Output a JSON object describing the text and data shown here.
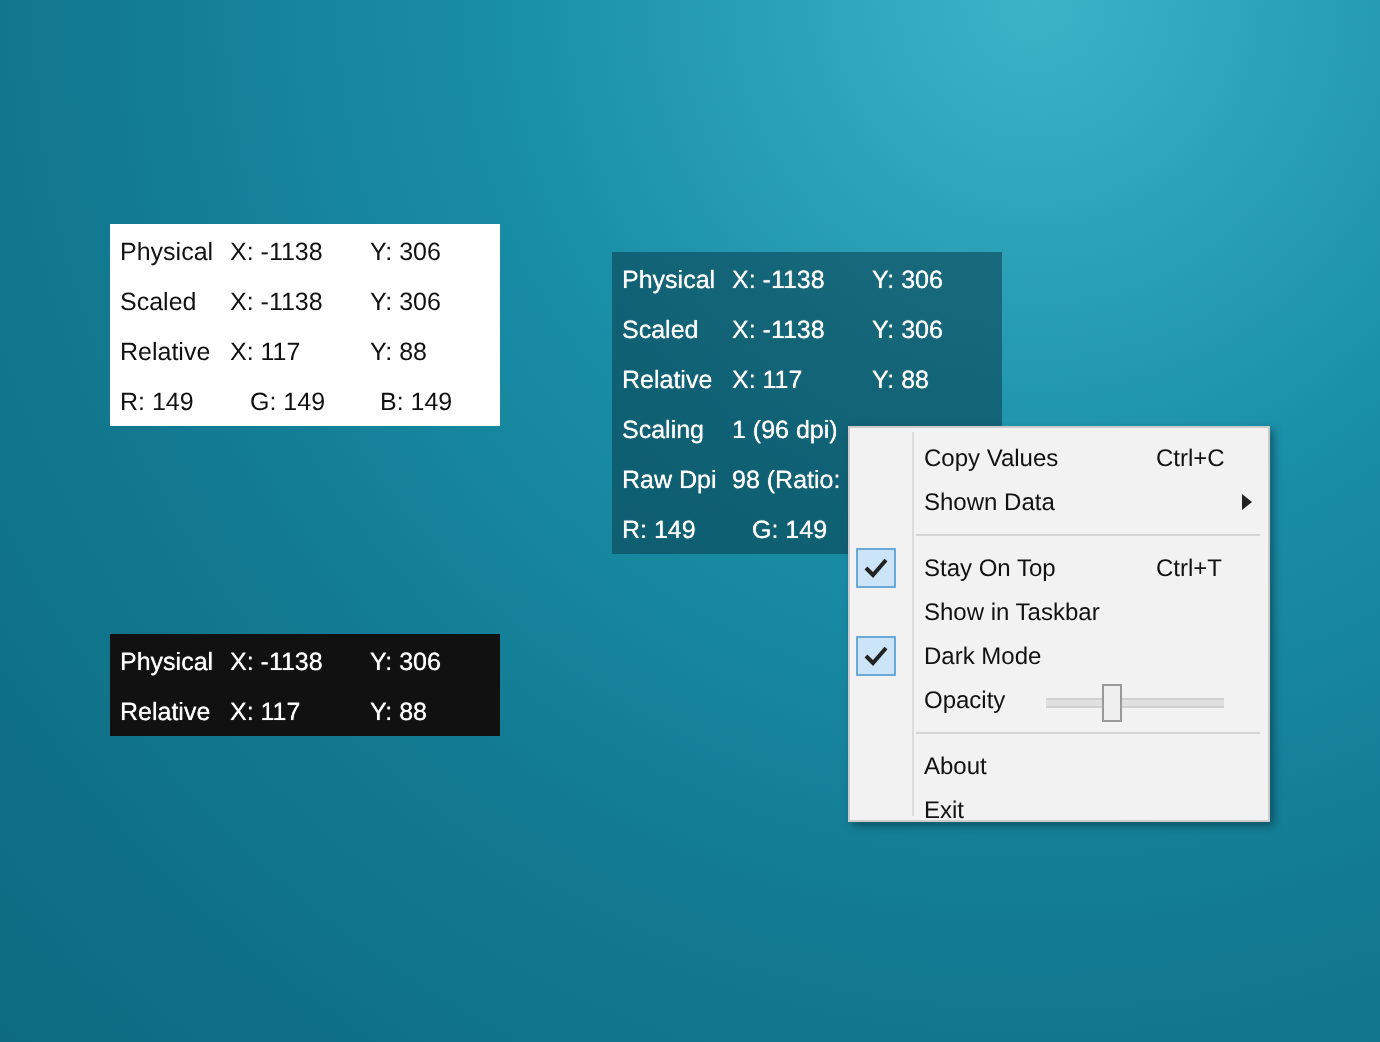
{
  "panels": [
    {
      "kind": "light",
      "rows": [
        {
          "kind": "coords",
          "cells": [
            "Physical",
            "X: -1138",
            "Y: 306"
          ]
        },
        {
          "kind": "coords",
          "cells": [
            "Scaled",
            "X: -1138",
            "Y: 306"
          ]
        },
        {
          "kind": "coords",
          "cells": [
            "Relative",
            "X: 117",
            "Y: 88"
          ]
        },
        {
          "kind": "rgb",
          "cells": [
            "R: 149",
            "G: 149",
            "B: 149"
          ]
        }
      ]
    },
    {
      "kind": "teal",
      "rows": [
        {
          "kind": "coords",
          "cells": [
            "Physical",
            "X: -1138",
            "Y: 306"
          ]
        },
        {
          "kind": "coords",
          "cells": [
            "Scaled",
            "X: -1138",
            "Y: 306"
          ]
        },
        {
          "kind": "coords",
          "cells": [
            "Relative",
            "X: 117",
            "Y: 88"
          ]
        },
        {
          "kind": "coords",
          "cells": [
            "Scaling",
            "1 (96 dpi)"
          ]
        },
        {
          "kind": "coords",
          "cells": [
            "Raw Dpi",
            "98  (Ratio:"
          ]
        },
        {
          "kind": "rgb",
          "cells": [
            "R: 149",
            "G: 149"
          ]
        }
      ]
    },
    {
      "kind": "dark",
      "rows": [
        {
          "kind": "coords",
          "cells": [
            "Physical",
            "X: -1138",
            "Y: 306"
          ]
        },
        {
          "kind": "coords",
          "cells": [
            "Relative",
            "X: 117",
            "Y: 88"
          ]
        }
      ]
    }
  ],
  "context_menu": {
    "items": [
      {
        "kind": "item",
        "label": "Copy Values",
        "shortcut": "Ctrl+C",
        "submenu": false,
        "checked": false
      },
      {
        "kind": "item",
        "label": "Shown Data",
        "submenu": true,
        "checked": false
      },
      {
        "kind": "separator"
      },
      {
        "kind": "item",
        "label": "Stay On Top",
        "shortcut": "Ctrl+T",
        "submenu": false,
        "checked": true
      },
      {
        "kind": "item",
        "label": "Show in Taskbar",
        "submenu": false,
        "checked": false
      },
      {
        "kind": "item",
        "label": "Dark Mode",
        "submenu": false,
        "checked": true
      },
      {
        "kind": "slider",
        "label": "Opacity",
        "level": 0.33
      },
      {
        "kind": "separator"
      },
      {
        "kind": "item",
        "label": "About",
        "submenu": false,
        "checked": false
      },
      {
        "kind": "item",
        "label": "Exit",
        "submenu": false,
        "checked": false
      }
    ]
  }
}
